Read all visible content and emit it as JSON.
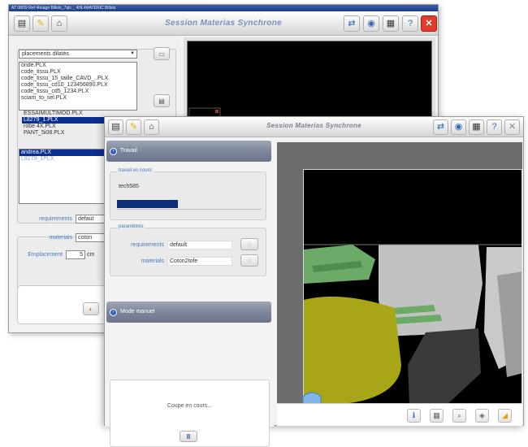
{
  "back_window": {
    "system_bar": "AT 08/09 Ref 4Image Billets_7qtc _ 4HL4MATERIC Billets",
    "title": "Session Materias Synchrone",
    "dropdown_value": "placements dilatés",
    "file_list": [
      {
        "label": "onde.PLX",
        "selected": false
      },
      {
        "label": "code_tissu.PLX",
        "selected": false
      },
      {
        "label": "code_tissu_15_taille_CAVD_..PLX",
        "selected": false
      },
      {
        "label": "code_tissu_cd10_123456890.PLX",
        "selected": false
      },
      {
        "label": "code_tissu_cd5_1234.PLX",
        "selected": false
      },
      {
        "label": "sciam_to_sel.PLX",
        "selected": false
      }
    ],
    "overflow_rows": [
      {
        "label": "ESSAIMULTIMOD.PLX",
        "selected": false
      },
      {
        "label": "L8279_1.PLX",
        "selected": true
      },
      {
        "label": "robe 4X.PLX",
        "selected": false
      },
      {
        "label": "PANT_5i08.PLX",
        "selected": false
      }
    ],
    "selected_list": [
      {
        "label": "andrea.PLX",
        "selected": true
      },
      {
        "label": "L8279_1PLX",
        "selected": false,
        "ghost": true
      }
    ],
    "form": {
      "requirements_label": "requirements",
      "requirements_value": "defaut",
      "materials_label": "materials",
      "materials_value": "coton",
      "emplacement_label": "Emplacement",
      "emplacement_value": "5",
      "emplacement_unit": "cm"
    }
  },
  "front_window": {
    "title": "Session Materias Synchrone",
    "travail_header": "Travail",
    "travail_en_cours_label": "travail en cours",
    "travail_file": "tech585",
    "progress_fraction": 0.42,
    "parametres_label": "paramètres",
    "requirements_label": "requirements",
    "requirements_value": "default",
    "materials_label": "materials",
    "materials_value": "Coton2tofe",
    "mode_manuel_header": "Mode manuel",
    "coupe_text": "Coupe en cours...",
    "pause_label": "II"
  },
  "colors": {
    "selection": "#0a2f8f",
    "header_gradient": "#7b8498",
    "piece_yellow": "#a8a617",
    "piece_green": "#6bab67",
    "piece_gray": "#bfbfbf"
  },
  "icons": {
    "toolbar_left": [
      "monitor-icon",
      "pencil-icon",
      "home-icon"
    ],
    "toolbar_right": [
      "network-icon",
      "globe-icon",
      "clipboard-icon",
      "help-icon",
      "close-icon"
    ],
    "bottom_bar": [
      "info-icon",
      "grid-icon",
      "zoom-icon",
      "layers-icon",
      "cut-icon"
    ]
  }
}
